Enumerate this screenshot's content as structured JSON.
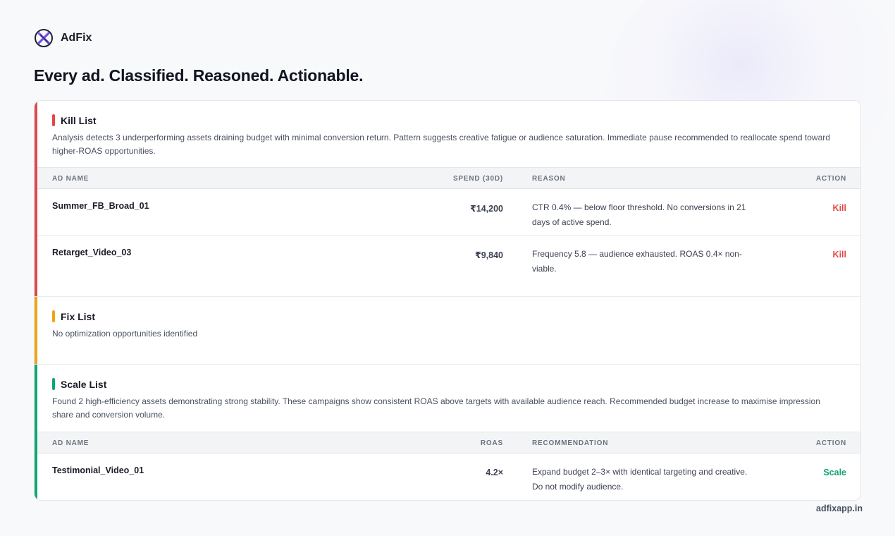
{
  "brand": {
    "name": "AdFix",
    "icon": "adfix-logo-icon"
  },
  "headline": "Every ad. Classified. Reasoned. Actionable.",
  "colors": {
    "kill": "#e04848",
    "fix": "#f0a416",
    "scale": "#12a571",
    "accent": "#6c4cf0"
  },
  "kill_list": {
    "title": "Kill List",
    "description": "Analysis detects 3 underperforming assets draining budget with minimal conversion return. Pattern suggests creative fatigue or audience saturation. Immediate pause recommended to reallocate spend toward higher-ROAS opportunities.",
    "columns": [
      "AD NAME",
      "SPEND (30D)",
      "REASON",
      "ACTION"
    ],
    "rows": [
      {
        "name": "Summer_FB_Broad_01",
        "spend": "₹14,200",
        "reason": "CTR 0.4% — below floor threshold. No conversions in 21 days of active spend.",
        "action": "Kill"
      },
      {
        "name": "Retarget_Video_03",
        "spend": "₹9,840",
        "reason": "Frequency 5.8 — audience exhausted. ROAS 0.4× non-viable.",
        "action": "Kill"
      }
    ]
  },
  "fix_list": {
    "title": "Fix List",
    "description": "No optimization opportunities identified"
  },
  "scale_list": {
    "title": "Scale List",
    "description": "Found 2 high-efficiency assets demonstrating strong stability. These campaigns show consistent ROAS above targets with available audience reach. Recommended budget increase to maximise impression share and conversion volume.",
    "columns": [
      "AD NAME",
      "ROAS",
      "RECOMMENDATION",
      "ACTION"
    ],
    "rows": [
      {
        "name": "Testimonial_Video_01",
        "roas": "4.2×",
        "recommendation": "Expand budget 2–3× with identical targeting and creative. Do not modify audience.",
        "action": "Scale"
      }
    ]
  },
  "footer": {
    "site": "adfixapp.in"
  }
}
